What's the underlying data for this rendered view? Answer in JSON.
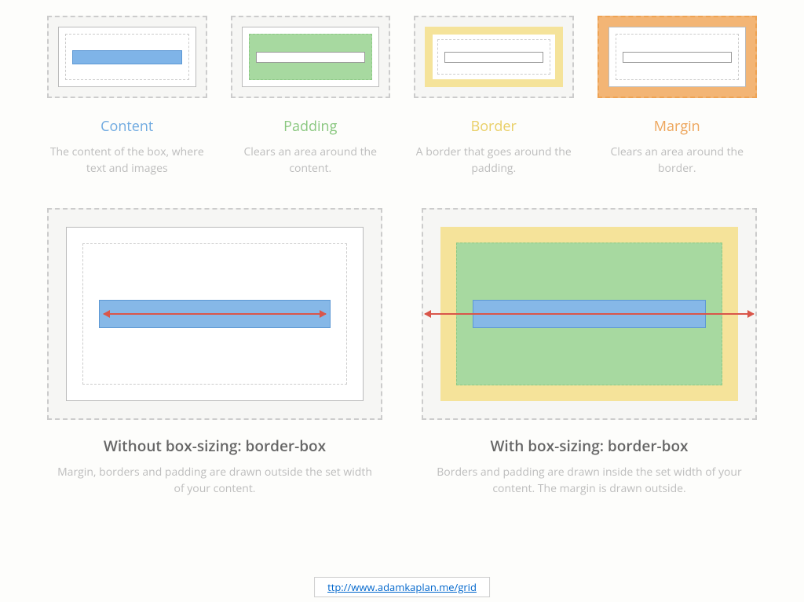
{
  "box_model": {
    "content": {
      "title": "Content",
      "desc": "The content of the box, where text and images"
    },
    "padding": {
      "title": "Padding",
      "desc": "Clears an area around the content."
    },
    "border": {
      "title": "Border",
      "desc": "A border that goes around the padding."
    },
    "margin": {
      "title": "Margin",
      "desc": "Clears an area around the border."
    }
  },
  "box_sizing": {
    "without": {
      "title": "Without box-sizing: border-box",
      "desc": "Margin, borders and padding are drawn outside the set width of your content."
    },
    "with": {
      "title": "With box-sizing: border-box",
      "desc": "Borders and padding are drawn inside the set width of your content. The margin is drawn outside."
    }
  },
  "source": {
    "text": "ttp://www.adamkaplan.me/grid"
  }
}
